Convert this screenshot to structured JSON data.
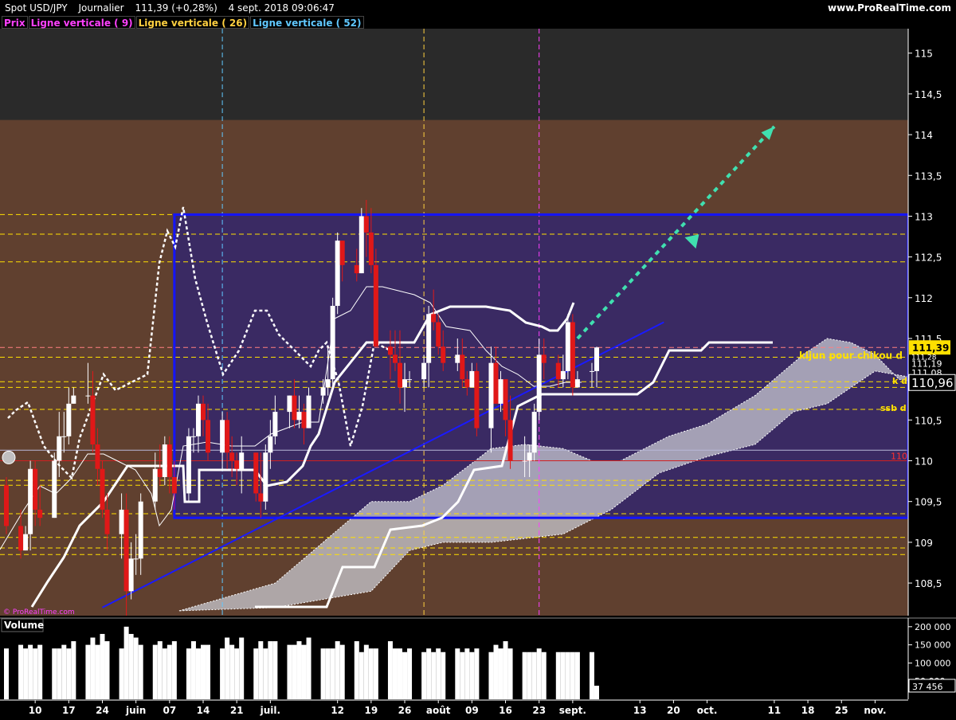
{
  "header": {
    "instrument": "Spot USD/JPY",
    "period": "Journalier",
    "quote": "111,39 (+0,28%)",
    "timestamp": "4 sept. 2018 09:06:47",
    "brand": "www.ProRealTime.com",
    "watermark": "© ProRealTime.com"
  },
  "legend": [
    {
      "label": "Prix",
      "color": "#ff40ff"
    },
    {
      "label": "Ligne verticale ( 9)",
      "color": "#ff40ff"
    },
    {
      "label": "Ligne verticale ( 26)",
      "color": "#ffd040"
    },
    {
      "label": "Ligne verticale ( 52)",
      "color": "#60c8ff"
    }
  ],
  "colors": {
    "background_outer": "#2a2a2a",
    "band_brown": "#60402f",
    "box_purple": "#3a2a63",
    "box_border": "#1414ff",
    "candle_up": "#ffffff",
    "candle_down": "#e01818",
    "cloud": "#c8c8d0",
    "kijun": "#ffffff",
    "chikou": "#ffffff",
    "projection_arrow": "#40e0b0",
    "level_line": "#ffe000",
    "price_box": "#ffe000"
  },
  "annotations": {
    "kijun_chikou": "kijun pour chikou d",
    "kijun_d": "k d",
    "ssb_d": "ssb d"
  },
  "price_axis": {
    "ticks": [
      "115",
      "114,5",
      "114",
      "113,5",
      "113",
      "112,5",
      "112",
      "111,5",
      "111",
      "110,5",
      "110",
      "109,5",
      "109",
      "108,5"
    ],
    "current_price": "111,39",
    "label_110_96": "110,96",
    "label_111_19": "111,19",
    "label_111_08": "111,08",
    "label_111_28": "111,28",
    "label_110_red": "110"
  },
  "volume_panel": {
    "title": "Volume",
    "ticks": [
      "200 000",
      "150 000",
      "100 000",
      "50 000"
    ],
    "last": "37 456"
  },
  "time_axis": [
    "10",
    "17",
    "24",
    "juin",
    "07",
    "14",
    "21",
    "juil.",
    "12",
    "19",
    "26",
    "août",
    "09",
    "16",
    "23",
    "sept.",
    "13",
    "20",
    "oct.",
    "11",
    "18",
    "25",
    "nov."
  ],
  "chart_data": {
    "type": "candlestick",
    "title": "Spot USD/JPY",
    "period": "Journalier",
    "ylim": [
      108.1,
      115.3
    ],
    "date_range": [
      "2018-05-04",
      "2018-09-04"
    ],
    "series": [
      {
        "name": "Prix",
        "type": "candlestick",
        "ohlc": [
          [
            "2018-05-04",
            109.7,
            109.8,
            109.1,
            109.2
          ],
          [
            "2018-05-07",
            109.2,
            109.4,
            108.8,
            108.9
          ],
          [
            "2018-05-08",
            108.9,
            109.2,
            108.9,
            109.1
          ],
          [
            "2018-05-09",
            109.1,
            110.0,
            108.9,
            109.9
          ],
          [
            "2018-05-10",
            109.9,
            110.0,
            109.2,
            109.4
          ],
          [
            "2018-05-11",
            109.4,
            109.7,
            109.2,
            109.3
          ],
          [
            "2018-05-14",
            109.3,
            110.1,
            109.3,
            110.0
          ],
          [
            "2018-05-15",
            110.0,
            110.6,
            109.8,
            110.3
          ],
          [
            "2018-05-16",
            110.3,
            110.6,
            110.1,
            110.3
          ],
          [
            "2018-05-17",
            110.3,
            110.9,
            110.2,
            110.7
          ],
          [
            "2018-05-18",
            110.7,
            110.9,
            110.7,
            110.8
          ],
          [
            "2018-05-21",
            110.8,
            111.2,
            110.7,
            110.8
          ],
          [
            "2018-05-22",
            110.8,
            111.1,
            110.1,
            110.2
          ],
          [
            "2018-05-23",
            110.2,
            110.4,
            109.7,
            109.9
          ],
          [
            "2018-05-24",
            109.9,
            110.0,
            109.3,
            109.4
          ],
          [
            "2018-05-25",
            109.4,
            109.6,
            108.9,
            109.1
          ],
          [
            "2018-05-28",
            109.1,
            109.6,
            108.8,
            109.4
          ],
          [
            "2018-05-29",
            109.4,
            109.6,
            108.1,
            108.4
          ],
          [
            "2018-05-30",
            108.4,
            109.0,
            108.3,
            108.8
          ],
          [
            "2018-05-31",
            108.8,
            109.1,
            108.6,
            108.8
          ],
          [
            "2018-06-01",
            108.8,
            109.6,
            108.6,
            109.5
          ],
          [
            "2018-06-04",
            109.5,
            110.1,
            109.4,
            109.9
          ],
          [
            "2018-06-05",
            109.9,
            110.2,
            109.7,
            109.8
          ],
          [
            "2018-06-06",
            109.8,
            110.3,
            109.7,
            110.2
          ],
          [
            "2018-06-07",
            110.2,
            110.3,
            109.6,
            109.8
          ],
          [
            "2018-06-08",
            109.8,
            110.0,
            109.4,
            109.6
          ],
          [
            "2018-06-11",
            109.6,
            110.4,
            109.5,
            110.3
          ],
          [
            "2018-06-12",
            110.3,
            110.4,
            110.1,
            110.3
          ],
          [
            "2018-06-13",
            110.3,
            110.8,
            110.1,
            110.7
          ],
          [
            "2018-06-14",
            110.7,
            110.8,
            110.3,
            110.5
          ],
          [
            "2018-06-15",
            110.5,
            110.7,
            110.0,
            110.1
          ],
          [
            "2018-06-18",
            110.1,
            110.6,
            109.9,
            110.5
          ],
          [
            "2018-06-19",
            110.5,
            110.6,
            109.9,
            110.1
          ],
          [
            "2018-06-20",
            110.1,
            110.3,
            109.8,
            110.0
          ],
          [
            "2018-06-21",
            110.0,
            110.1,
            109.7,
            109.9
          ],
          [
            "2018-06-22",
            109.9,
            110.3,
            109.6,
            110.1
          ],
          [
            "2018-06-25",
            110.1,
            110.1,
            109.5,
            109.6
          ],
          [
            "2018-06-26",
            109.6,
            110.1,
            109.3,
            109.5
          ],
          [
            "2018-06-27",
            109.5,
            110.2,
            109.4,
            110.1
          ],
          [
            "2018-06-28",
            110.1,
            110.5,
            109.9,
            110.3
          ],
          [
            "2018-06-29",
            110.3,
            110.8,
            110.2,
            110.6
          ],
          [
            "2018-07-02",
            110.6,
            110.8,
            110.4,
            110.8
          ],
          [
            "2018-07-03",
            110.8,
            111.0,
            110.4,
            110.5
          ],
          [
            "2018-07-04",
            110.5,
            110.8,
            110.4,
            110.6
          ],
          [
            "2018-07-05",
            110.6,
            110.7,
            110.2,
            110.4
          ],
          [
            "2018-07-06",
            110.4,
            110.9,
            110.4,
            110.8
          ],
          [
            "2018-07-09",
            110.8,
            111.0,
            110.7,
            110.9
          ],
          [
            "2018-07-10",
            110.9,
            111.4,
            110.8,
            111.0
          ],
          [
            "2018-07-11",
            111.0,
            112.0,
            110.9,
            111.9
          ],
          [
            "2018-07-12",
            111.9,
            112.8,
            111.8,
            112.7
          ],
          [
            "2018-07-13",
            112.7,
            112.7,
            112.2,
            112.4
          ],
          [
            "2018-07-16",
            112.4,
            112.6,
            112.2,
            112.3
          ],
          [
            "2018-07-17",
            112.3,
            113.1,
            112.3,
            113.0
          ],
          [
            "2018-07-18",
            113.0,
            113.2,
            112.5,
            112.8
          ],
          [
            "2018-07-19",
            112.8,
            113.1,
            112.3,
            112.4
          ],
          [
            "2018-07-20",
            112.4,
            112.6,
            111.4,
            111.4
          ],
          [
            "2018-07-23",
            111.4,
            111.6,
            111.0,
            111.3
          ],
          [
            "2018-07-24",
            111.3,
            111.6,
            111.1,
            111.2
          ],
          [
            "2018-07-25",
            111.2,
            111.6,
            110.7,
            110.9
          ],
          [
            "2018-07-26",
            110.9,
            111.2,
            110.6,
            111.0
          ],
          [
            "2018-07-27",
            111.0,
            111.1,
            110.9,
            111.0
          ],
          [
            "2018-07-30",
            111.0,
            111.3,
            110.9,
            111.2
          ],
          [
            "2018-07-31",
            111.2,
            111.9,
            110.9,
            111.8
          ],
          [
            "2018-08-01",
            111.8,
            112.1,
            111.6,
            111.7
          ],
          [
            "2018-08-02",
            111.7,
            111.8,
            111.3,
            111.4
          ],
          [
            "2018-08-03",
            111.4,
            111.6,
            111.1,
            111.2
          ],
          [
            "2018-08-06",
            111.2,
            111.5,
            111.1,
            111.3
          ],
          [
            "2018-08-07",
            111.3,
            111.5,
            110.9,
            111.0
          ],
          [
            "2018-08-08",
            111.0,
            111.1,
            110.8,
            110.9
          ],
          [
            "2018-08-09",
            110.9,
            111.2,
            110.9,
            111.1
          ],
          [
            "2018-08-10",
            111.1,
            111.2,
            110.3,
            110.4
          ],
          [
            "2018-08-13",
            110.4,
            111.4,
            110.1,
            111.2
          ],
          [
            "2018-08-14",
            111.2,
            111.4,
            110.7,
            110.7
          ],
          [
            "2018-08-15",
            110.7,
            111.1,
            110.6,
            111.0
          ],
          [
            "2018-08-16",
            111.0,
            111.0,
            110.3,
            110.5
          ],
          [
            "2018-08-17",
            110.5,
            110.8,
            109.9,
            110.0
          ],
          [
            "2018-08-20",
            110.0,
            110.3,
            109.8,
            110.0
          ],
          [
            "2018-08-21",
            110.0,
            110.2,
            109.8,
            110.1
          ],
          [
            "2018-08-22",
            110.1,
            110.7,
            110.0,
            110.6
          ],
          [
            "2018-08-23",
            110.6,
            111.5,
            110.5,
            111.3
          ],
          [
            "2018-08-24",
            111.3,
            111.5,
            111.0,
            111.2
          ],
          [
            "2018-08-27",
            111.2,
            111.3,
            110.9,
            111.0
          ],
          [
            "2018-08-28",
            111.0,
            111.3,
            110.9,
            111.1
          ],
          [
            "2018-08-29",
            111.1,
            111.8,
            111.0,
            111.7
          ],
          [
            "2018-08-30",
            111.7,
            111.8,
            110.8,
            110.9
          ],
          [
            "2018-08-31",
            110.9,
            111.1,
            110.9,
            111.0
          ],
          [
            "2018-09-03",
            111.1,
            111.2,
            110.9,
            111.1
          ],
          [
            "2018-09-04",
            111.1,
            111.4,
            110.9,
            111.39
          ]
        ]
      },
      {
        "name": "Volume",
        "type": "bar",
        "values": [
          140000,
          150000,
          140000,
          150000,
          140000,
          150000,
          140000,
          140000,
          150000,
          140000,
          160000,
          150000,
          170000,
          150000,
          180000,
          160000,
          140000,
          200000,
          180000,
          170000,
          150000,
          150000,
          160000,
          140000,
          150000,
          160000,
          140000,
          160000,
          140000,
          150000,
          150000,
          140000,
          170000,
          150000,
          140000,
          170000,
          140000,
          160000,
          140000,
          160000,
          160000,
          150000,
          150000,
          160000,
          150000,
          170000,
          140000,
          140000,
          140000,
          160000,
          150000,
          160000,
          130000,
          150000,
          140000,
          140000,
          160000,
          140000,
          140000,
          130000,
          140000,
          130000,
          140000,
          130000,
          140000,
          130000,
          140000,
          130000,
          140000,
          130000,
          140000,
          130000,
          150000,
          140000,
          160000,
          140000,
          130000,
          130000,
          130000,
          140000,
          130000,
          130000,
          130000,
          130000,
          130000,
          130000,
          130000,
          37456
        ]
      }
    ],
    "horizontal_levels": {
      "yellow_dashed": [
        113.02,
        112.78,
        112.44,
        111.27,
        110.97,
        110.9,
        110.63,
        109.76,
        109.7,
        109.35,
        109.06,
        108.93,
        108.85
      ],
      "red_line": 110.0,
      "pink_dashed": 111.39,
      "gray_line": 110.13
    },
    "vertical_markers": [
      {
        "name": "Ligne verticale ( 52)",
        "date": "2018-06-18"
      },
      {
        "name": "Ligne verticale ( 26)",
        "date": "2018-07-30"
      },
      {
        "name": "Ligne verticale ( 9)",
        "date": "2018-08-23"
      }
    ],
    "range_box": {
      "from": "2018-06-08",
      "to": "2018-10-25",
      "top": 113.02,
      "bottom": 109.3
    },
    "trendline": {
      "from": [
        "2018-05-24",
        108.2
      ],
      "to": [
        "2018-09-18",
        111.7
      ]
    },
    "projection": {
      "from": [
        "2018-08-31",
        111.5
      ],
      "to": [
        "2018-10-11",
        114.1
      ]
    },
    "xlabel": "",
    "ylabel": ""
  }
}
